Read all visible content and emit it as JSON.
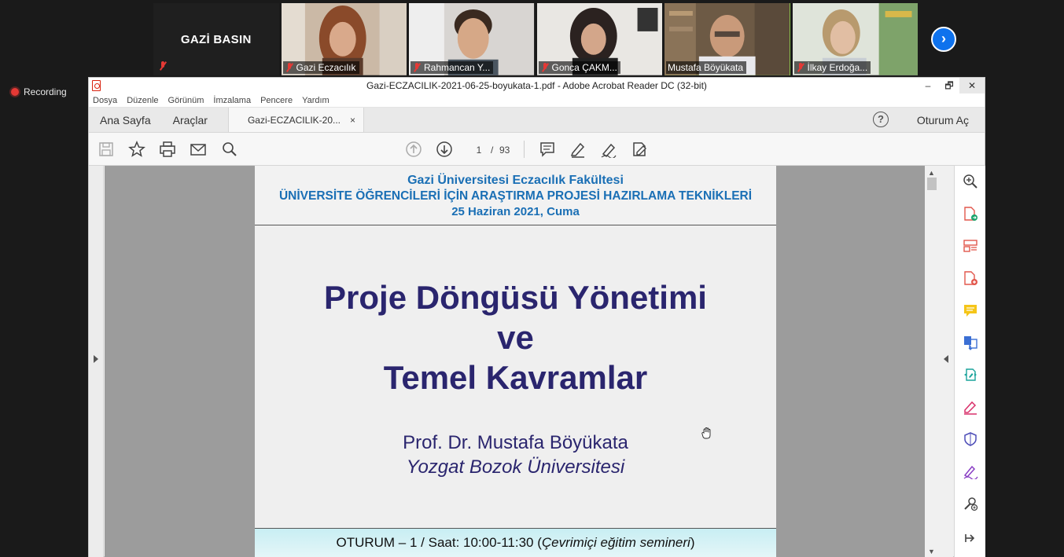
{
  "meeting": {
    "recording_label": "Recording",
    "gallery": [
      {
        "name": "GAZİ BASIN",
        "kind": "name-only",
        "muted": true,
        "active": false
      },
      {
        "name": "Gazi Eczacılık",
        "kind": "video",
        "muted": true,
        "active": false
      },
      {
        "name": "Rahmancan Y...",
        "kind": "video",
        "muted": true,
        "active": false
      },
      {
        "name": "Gonca ÇAKM...",
        "kind": "video",
        "muted": true,
        "active": false
      },
      {
        "name": "Mustafa Böyükata",
        "kind": "video",
        "muted": false,
        "active": true
      },
      {
        "name": "İlkay Erdoğa...",
        "kind": "video",
        "muted": true,
        "active": false
      }
    ],
    "next_icon": "chevron-right-icon"
  },
  "window": {
    "title": "Gazi-ECZACILIK-2021-06-25-boyukata-1.pdf - Adobe Acrobat Reader DC (32-bit)",
    "minimize": "–",
    "maximize": "🗗",
    "close": "✕"
  },
  "menu": [
    "Dosya",
    "Düzenle",
    "Görünüm",
    "İmzalama",
    "Pencere",
    "Yardım"
  ],
  "tabs": {
    "home": "Ana Sayfa",
    "tools": "Araçlar",
    "document": "Gazi-ECZACILIK-20...",
    "close": "×",
    "help": "?",
    "sign_in": "Oturum Aç"
  },
  "toolbar": {
    "current_page": "1",
    "separator": "/",
    "total_pages": "93"
  },
  "pdf": {
    "header_line1": "Gazi Üniversitesi Eczacılık Fakültesi",
    "header_line2": "ÜNİVERSİTE ÖĞRENCİLERİ İÇİN ARAŞTIRMA PROJESİ HAZIRLAMA TEKNİKLERİ",
    "header_line3": "25 Haziran 2021, Cuma",
    "title_line1": "Proje Döngüsü Yönetimi",
    "title_line2": "ve",
    "title_line3": "Temel Kavramlar",
    "author": "Prof. Dr. Mustafa Böyükata",
    "affiliation": "Yozgat Bozok Üniversitesi",
    "session_main": "OTURUM – 1 / Saat: 10:00-11:30 (",
    "session_italic": "Çevrimiçi eğitim semineri",
    "session_close": ")"
  },
  "colors": {
    "header_blue": "#1a6fb5",
    "title_navy": "#2a256e",
    "zoom_blue": "#0e72ed",
    "active_speaker": "#8bc34a",
    "muted_red": "#e53935"
  }
}
